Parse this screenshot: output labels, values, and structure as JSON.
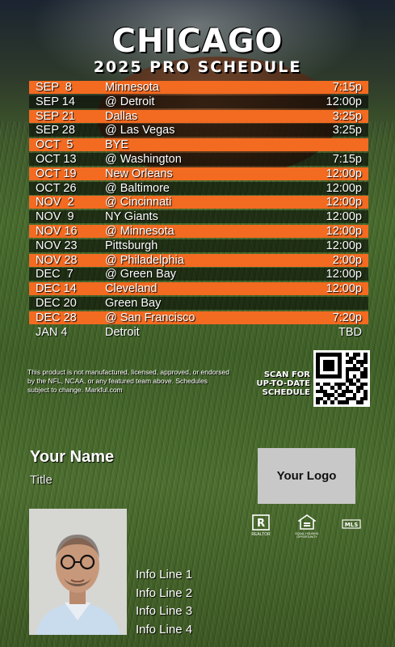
{
  "header": {
    "city": "CHICAGO",
    "subtitle": "2025 PRO SCHEDULE"
  },
  "colors": {
    "accent_orange": "#f36a21",
    "dark_row": "#1a1a1a",
    "text": "#ffffff"
  },
  "schedule": [
    {
      "date": "SEP  8",
      "opponent": "Minnesota",
      "time": "7:15p",
      "style": "orange"
    },
    {
      "date": "SEP 14",
      "opponent": "@ Detroit",
      "time": "12:00p",
      "style": "dark"
    },
    {
      "date": "SEP 21",
      "opponent": "Dallas",
      "time": "3:25p",
      "style": "orange"
    },
    {
      "date": "SEP 28",
      "opponent": "@ Las Vegas",
      "time": "3:25p",
      "style": "dark"
    },
    {
      "date": "OCT  5",
      "opponent": "BYE",
      "time": "",
      "style": "orange"
    },
    {
      "date": "OCT 13",
      "opponent": "@ Washington",
      "time": "7:15p",
      "style": "dark"
    },
    {
      "date": "OCT 19",
      "opponent": "New Orleans",
      "time": "12:00p",
      "style": "orange"
    },
    {
      "date": "OCT 26",
      "opponent": "@ Baltimore",
      "time": "12:00p",
      "style": "dark"
    },
    {
      "date": "NOV  2",
      "opponent": "@ Cincinnati",
      "time": "12:00p",
      "style": "orange"
    },
    {
      "date": "NOV  9",
      "opponent": "NY Giants",
      "time": "12:00p",
      "style": "dark"
    },
    {
      "date": "NOV 16",
      "opponent": "@ Minnesota",
      "time": "12:00p",
      "style": "orange"
    },
    {
      "date": "NOV 23",
      "opponent": "Pittsburgh",
      "time": "12:00p",
      "style": "dark"
    },
    {
      "date": "NOV 28",
      "opponent": "@ Philadelphia",
      "time": "2:00p",
      "style": "orange"
    },
    {
      "date": "DEC  7",
      "opponent": "@ Green Bay",
      "time": "12:00p",
      "style": "dark"
    },
    {
      "date": "DEC 14",
      "opponent": "Cleveland",
      "time": "12:00p",
      "style": "orange"
    },
    {
      "date": "DEC 20",
      "opponent": "Green Bay",
      "time": "",
      "style": "dark"
    },
    {
      "date": "DEC 28",
      "opponent": "@ San Francisco",
      "time": "7:20p",
      "style": "orange"
    },
    {
      "date": "JAN 4",
      "opponent": "Detroit",
      "time": "TBD",
      "style": "clear"
    }
  ],
  "disclaimer": "This product is not manufactured, licensed, approved, or endorsed by the NFL, NCAA, or any featured team above. Schedules subject to change. Markful.com",
  "qr": {
    "caption_line1": "SCAN FOR",
    "caption_line2": "UP-TO-DATE",
    "caption_line3": "SCHEDULE",
    "icon": "qr-code"
  },
  "agent": {
    "name": "Your Name",
    "title": "Title",
    "logo_placeholder": "Your Logo",
    "info_lines": [
      "Info Line 1",
      "Info Line 2",
      "Info Line 3",
      "Info Line 4"
    ]
  },
  "badges": {
    "realtor": "REALTOR",
    "equal_housing": "EQUAL HOUSING OPPORTUNITY",
    "mls": "MLS"
  }
}
